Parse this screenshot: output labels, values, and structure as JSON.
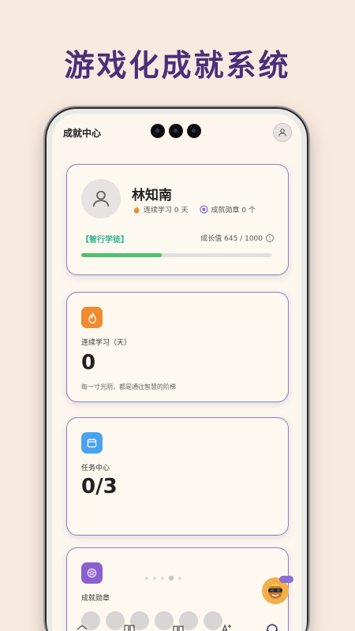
{
  "headline": "游戏化成就系统",
  "app": {
    "title": "成就中心"
  },
  "profile": {
    "name": "林知南",
    "streak_text": "连续学习 0 天",
    "badges_text": "成就勋章 0 个",
    "level": "【智行学徒】",
    "growth_text": "成长值 645 / 1000",
    "growth_fraction": 0.42
  },
  "cards": {
    "streak": {
      "label": "连续学习（天）",
      "value": "0",
      "sub": "每一寸光阴，都是通往智慧的阶梯"
    },
    "tasks": {
      "label": "任务中心",
      "value": "0/3"
    },
    "badges": {
      "label": "成就勋章"
    }
  },
  "pager": {
    "count": 5,
    "active_index": 3
  },
  "icons": {
    "avatar": "user-icon",
    "streak": "fire-icon",
    "badge": "medal-icon",
    "tasks": "calendar-icon",
    "achievement": "star-badge-icon",
    "info": "info-icon"
  },
  "colors": {
    "headline": "#4a2f7a",
    "card_border": "#8d7fc4",
    "level": "#2bb58a",
    "progress": "#4cc06c",
    "streak_icon": "#f08a2e",
    "tasks_icon": "#4aa3f0",
    "badge_icon": "#8a5fd0"
  }
}
